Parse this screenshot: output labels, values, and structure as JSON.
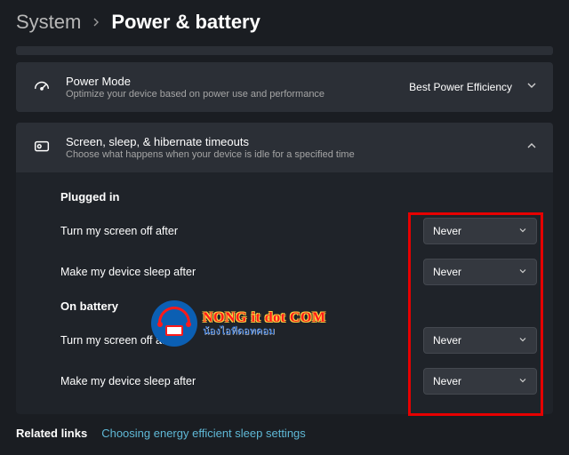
{
  "breadcrumb": {
    "parent": "System",
    "current": "Power & battery"
  },
  "powerMode": {
    "title": "Power Mode",
    "desc": "Optimize your device based on power use and performance",
    "value": "Best Power Efficiency"
  },
  "timeouts": {
    "title": "Screen, sleep, & hibernate timeouts",
    "desc": "Choose what happens when your device is idle for a specified time"
  },
  "sections": {
    "pluggedIn": {
      "label": "Plugged in",
      "screenOff": {
        "label": "Turn my screen off after",
        "value": "Never"
      },
      "sleep": {
        "label": "Make my device sleep after",
        "value": "Never"
      }
    },
    "onBattery": {
      "label": "On battery",
      "screenOff": {
        "label": "Turn my screen off after",
        "value": "Never"
      },
      "sleep": {
        "label": "Make my device sleep after",
        "value": "Never"
      }
    }
  },
  "related": {
    "label": "Related links",
    "link": "Choosing energy efficient sleep settings"
  },
  "watermark": {
    "line1": "NONG it dot COM",
    "line2": "น้องไอทีดอทคอม"
  }
}
